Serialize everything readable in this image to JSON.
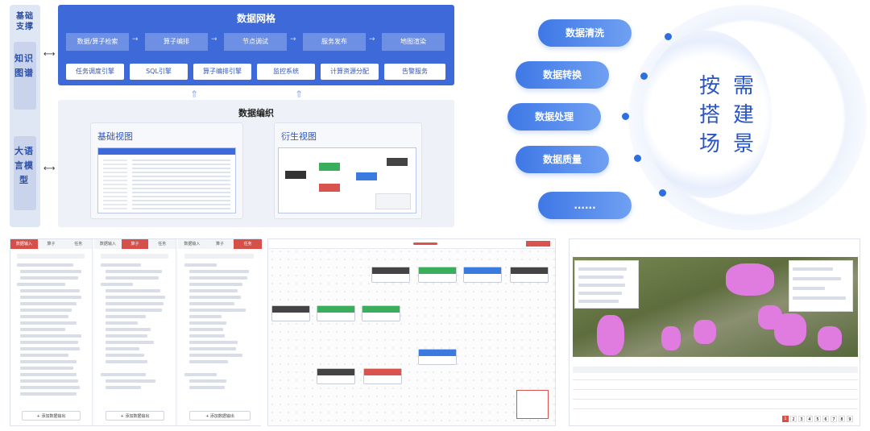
{
  "left": {
    "top_label": "基础支撑",
    "mid_label": "知识图谱",
    "bot_label": "大语言模型"
  },
  "grid": {
    "title": "数据网格",
    "flow": [
      "数据/算子检索",
      "算子编排",
      "节点调试",
      "服务发布",
      "地图渲染"
    ],
    "engines": [
      "任务调度引擎",
      "SQL引擎",
      "算子编排引擎",
      "监控系统",
      "计算资源分配",
      "告警服务"
    ]
  },
  "weave": {
    "title": "数据编织",
    "base_view": "基础视图",
    "derived_view": "衍生视图"
  },
  "right": {
    "pills": [
      "数据清洗",
      "数据转换",
      "数据处理",
      "数据质量",
      "......"
    ],
    "center": [
      "按",
      "需",
      "搭",
      "建",
      "场",
      "景"
    ]
  },
  "panels": {
    "p1": {
      "col_tabs": [
        [
          "数据输入",
          "算子",
          "任务"
        ],
        [
          "数据输入",
          "算子",
          "任务"
        ],
        [
          "数据输入",
          "算子",
          "任务"
        ]
      ],
      "active_tab_index": [
        0,
        1,
        2
      ],
      "add_button": "+ 添加数据输出"
    },
    "p3": {
      "pagination": [
        "1",
        "2",
        "3",
        "4",
        "5",
        "6",
        "7",
        "8",
        "9"
      ]
    }
  },
  "colors": {
    "primary": "#3d6ad8",
    "accent_red": "#d6504a",
    "magenta_map": "#e07be0"
  }
}
